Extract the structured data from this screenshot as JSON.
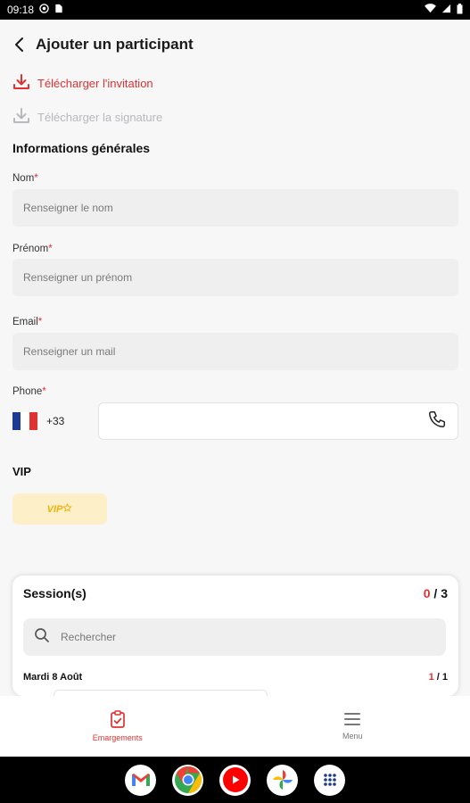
{
  "statusbar": {
    "time": "09:18"
  },
  "header": {
    "title": "Ajouter un participant"
  },
  "actions": {
    "download_invitation": "Télécharger l'invitation",
    "download_signature": "Télécharger la signature"
  },
  "section_title": "Informations générales",
  "fields": {
    "nom": {
      "label": "Nom",
      "placeholder": "Renseigner le nom"
    },
    "prenom": {
      "label": "Prénom",
      "placeholder": "Renseigner un prénom"
    },
    "email": {
      "label": "Email",
      "placeholder": "Renseigner un mail"
    },
    "phone": {
      "label": "Phone",
      "code": "+33",
      "value": ""
    }
  },
  "required_marker": "*",
  "vip": {
    "title": "VIP",
    "badge": "VIP"
  },
  "sessions": {
    "title": "Session(s)",
    "selected": "0",
    "total": " / 3",
    "search_placeholder": "Rechercher",
    "date": "Mardi 8 Août",
    "date_selected": "1",
    "date_total": " / 1"
  },
  "nav": {
    "emargements": "Emargements",
    "menu": "Menu"
  },
  "colors": {
    "accent": "#e03131",
    "vip_bg": "#fdf0c8",
    "vip_fg": "#f1b10c"
  }
}
